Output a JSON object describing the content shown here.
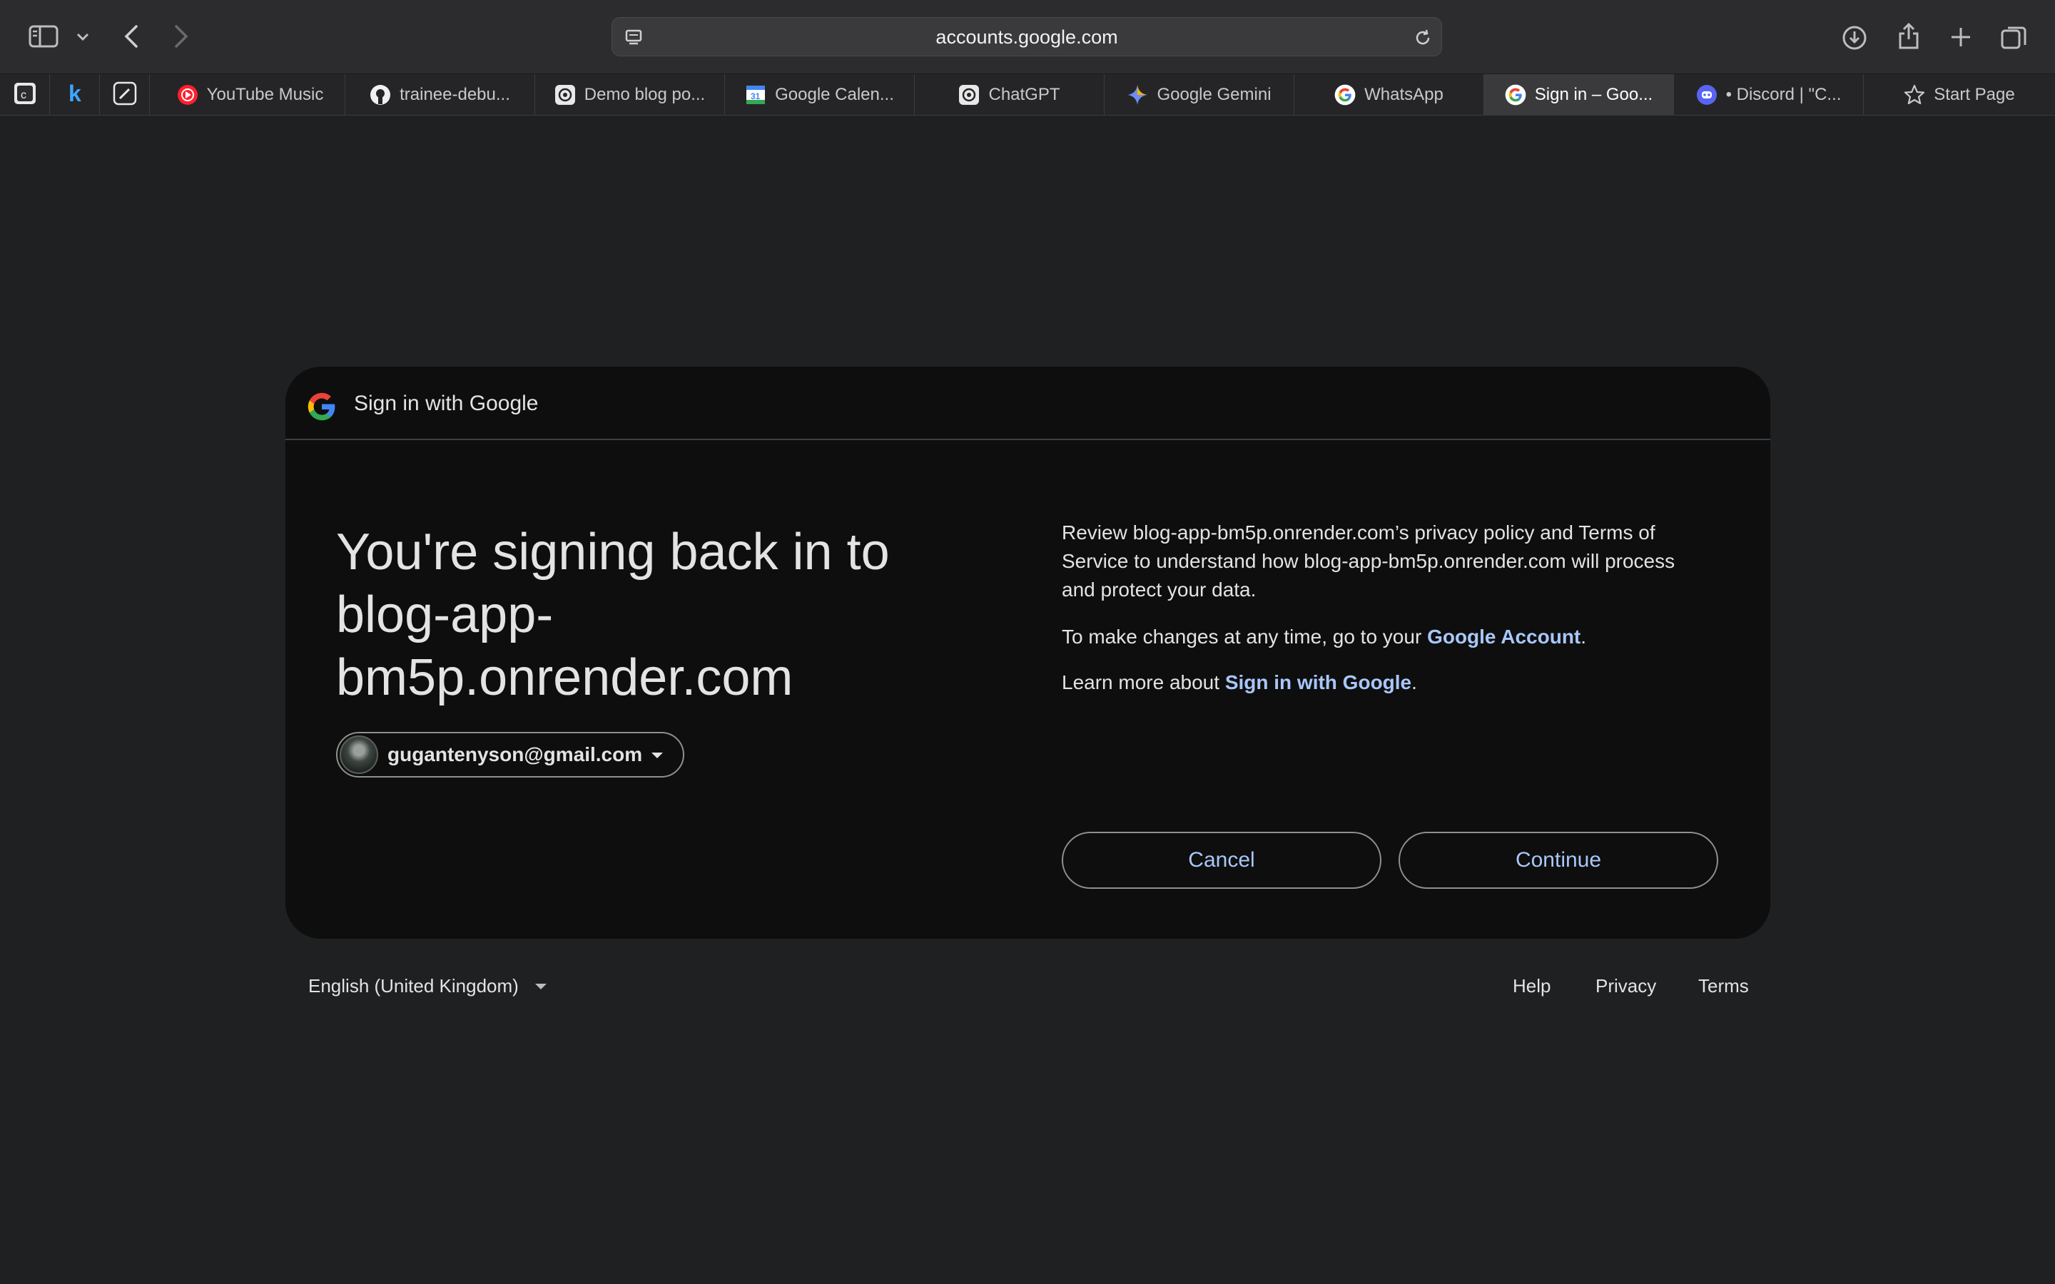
{
  "browser": {
    "url": "accounts.google.com",
    "tabs": [
      {
        "label": "YouTube Music",
        "icon": "youtube-music-icon",
        "active": false
      },
      {
        "label": "trainee-debu...",
        "icon": "github-icon",
        "active": false
      },
      {
        "label": "Demo blog po...",
        "icon": "openai-icon",
        "active": false
      },
      {
        "label": "Google Calen...",
        "icon": "google-calendar-icon",
        "active": false
      },
      {
        "label": "ChatGPT",
        "icon": "openai-icon",
        "active": false
      },
      {
        "label": "Google Gemini",
        "icon": "gemini-icon",
        "active": false
      },
      {
        "label": "WhatsApp",
        "icon": "google-icon",
        "active": false
      },
      {
        "label": "Sign in – Goo...",
        "icon": "google-icon",
        "active": true
      },
      {
        "label": "• Discord | \"C...",
        "icon": "discord-icon",
        "active": false
      },
      {
        "label": "Start Page",
        "icon": "star-icon",
        "active": false
      }
    ]
  },
  "dialog": {
    "header_title": "Sign in with Google",
    "headline_line1": "You're signing back in to",
    "headline_line2": "blog-app-",
    "headline_line3": "bm5p.onrender.com",
    "account_email": "gugantenyson@gmail.com",
    "review_text": "Review blog-app-bm5p.onrender.com’s privacy policy and Terms of Service to understand how blog-app-bm5p.onrender.com will process and protect your data.",
    "changes_prefix": "To make changes at any time, go to your ",
    "changes_link": "Google Account",
    "changes_suffix": ".",
    "learn_prefix": "Learn more about ",
    "learn_link": "Sign in with Google",
    "learn_suffix": ".",
    "cancel_label": "Cancel",
    "continue_label": "Continue"
  },
  "footer": {
    "language": "English (United Kingdom)",
    "help": "Help",
    "privacy": "Privacy",
    "terms": "Terms"
  },
  "colors": {
    "page_bg": "#1f2022",
    "dialog_bg": "#0e0e0e",
    "link": "#a8c7fa"
  }
}
